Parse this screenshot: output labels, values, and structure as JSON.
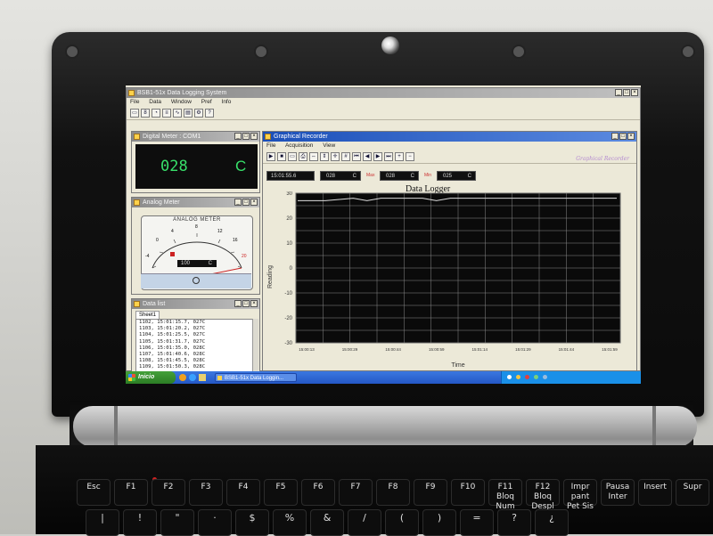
{
  "colors": {
    "display_green": "#38e06a",
    "plot_bg": "#0a0a0a",
    "trace": "#dcdcdc",
    "grid": "#8a8a8a",
    "xp_title": "#1b4fb8"
  },
  "main_window": {
    "title": "BSB1-51x Data Logging System",
    "menu": [
      "File",
      "Data",
      "Window",
      "Pref",
      "Info"
    ]
  },
  "digital_meter": {
    "title": "Digital Meter : COM1",
    "value": "028",
    "unit": "C"
  },
  "analog_meter": {
    "title": "Analog Meter",
    "face_label": "ANALOG METER",
    "readout": "100",
    "unit": "C",
    "scale": [
      "-4",
      "0",
      "4",
      "8",
      "12",
      "16",
      "20"
    ]
  },
  "data_list": {
    "title": "Data list",
    "sheet_tab": "Sheet1",
    "rows": [
      "1102, 15:01:15.7, 027C",
      "1103, 15:01:20.2, 027C",
      "1104, 15:01:25.5, 027C",
      "1105, 15:01:31.7, 027C",
      "1106, 15:01:35.0, 028C",
      "1107, 15:01:40.6, 028C",
      "1108, 15:01:45.5, 028C",
      "1109, 15:01:50.3, 028C"
    ]
  },
  "graphical_recorder": {
    "title": "Graphical Recorder",
    "menu": [
      "File",
      "Acquisition",
      "View"
    ],
    "brand": "Graphical Recorder",
    "time_readout": "15:01:55.6",
    "current": {
      "value": "028",
      "unit": "C"
    },
    "max": {
      "label": "Max",
      "value": "028",
      "unit": "C"
    },
    "min": {
      "label": "Min",
      "value": "025",
      "unit": "C"
    }
  },
  "chart_data": {
    "type": "line",
    "title": "Data Logger",
    "xlabel": "Time",
    "ylabel": "Reading",
    "ylim": [
      -30,
      30
    ],
    "y_ticks": [
      "30",
      "20",
      "10",
      "0",
      "-10",
      "-20",
      "-30"
    ],
    "x_ticks": [
      "15:00:13",
      "15:00:29",
      "15:00:44",
      "15:00:59",
      "15:01:14",
      "15:01:29",
      "15:01:44",
      "15:01:59"
    ],
    "grid": true,
    "series": [
      {
        "values": [
          27,
          27,
          27,
          27.5,
          28,
          27,
          28,
          28,
          28,
          28,
          27,
          28,
          28,
          28,
          28,
          28,
          28,
          28,
          28,
          28,
          28,
          28,
          28,
          28
        ]
      }
    ]
  },
  "taskbar": {
    "start_label": "Inicio",
    "buttons": [
      "BSB1-51x Data Loggin..."
    ]
  },
  "keyboard": {
    "fn_keys": [
      "Esc",
      "F1",
      "F2",
      "F3",
      "F4",
      "F5",
      "F6",
      "F7",
      "F8",
      "F9",
      "F10",
      "F11 Bloq Num",
      "F12 Bloq Despl",
      "Impr pant Pet Sis",
      "Pausa Inter",
      "Insert",
      "Supr"
    ],
    "num_keys": [
      "|",
      "!",
      "\"",
      "·",
      "$",
      "%",
      "&",
      "/",
      "(",
      ")",
      "=",
      "?",
      "¿"
    ]
  }
}
